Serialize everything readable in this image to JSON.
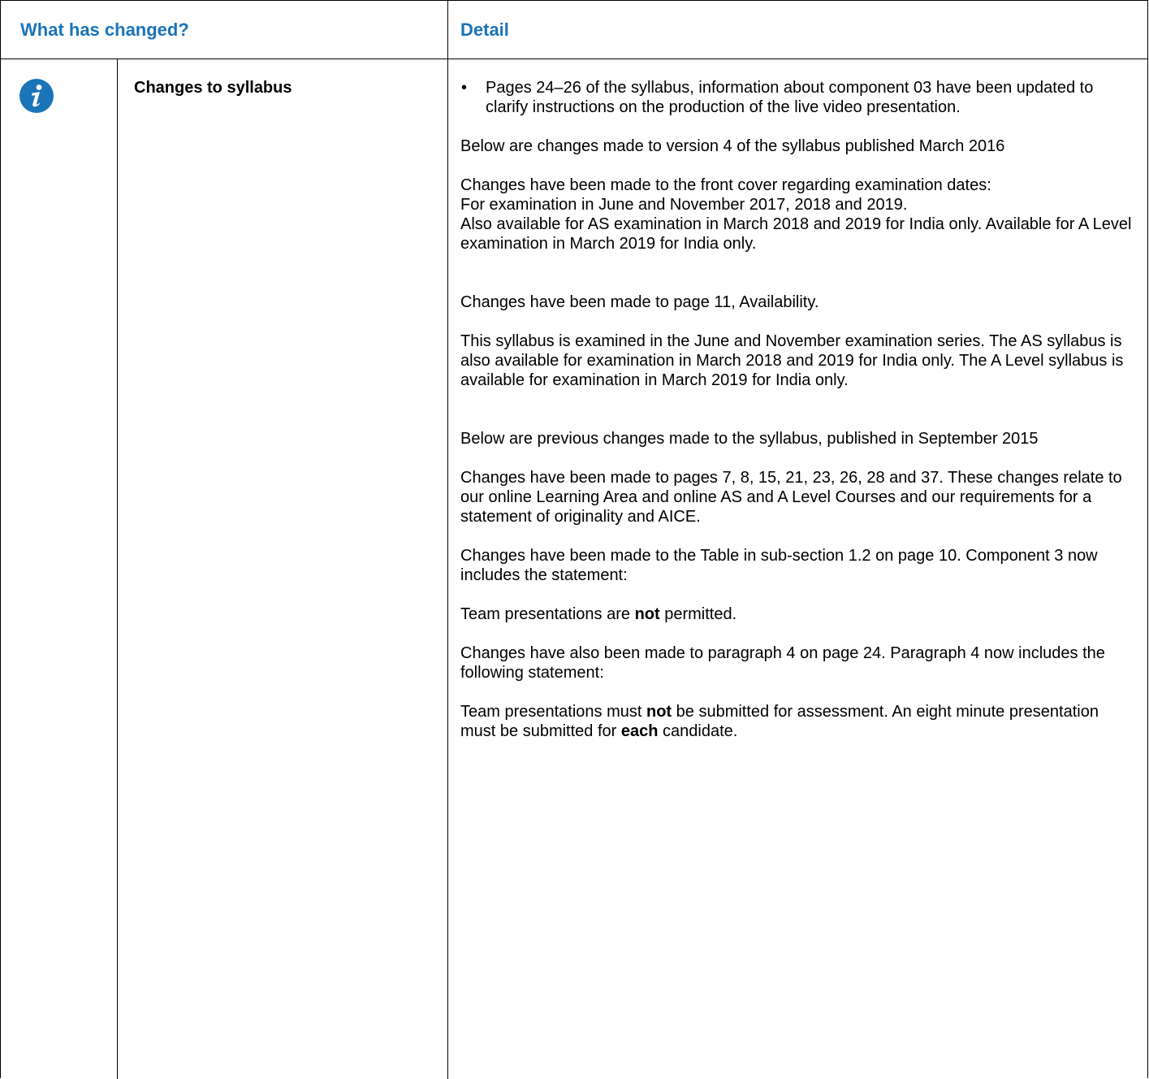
{
  "header": {
    "col_changed": "What has changed?",
    "col_detail": "Detail"
  },
  "icon": {
    "name": "info-icon",
    "color": "#1a74b8"
  },
  "row": {
    "label": "Changes to syllabus",
    "bullet": "Pages 24–26 of the syllabus, information about component 03 have been updated to clarify instructions on the production of the live video presentation.",
    "p1": "Below are changes made to version 4 of the syllabus published March 2016",
    "p2_lines": [
      "Changes have been made to the front cover regarding examination dates:",
      "For examination in June and November 2017, 2018 and 2019.",
      "Also available for AS examination in March 2018 and 2019 for India only. Available for A Level examination in March 2019 for India only."
    ],
    "p3": "Changes have been made to page 11, Availability.",
    "p4": "This syllabus is examined in the June and November examination series. The AS syllabus is also available for examination in March 2018 and 2019 for India only. The A Level syllabus is available for examination in March 2019 for India only.",
    "p5": "Below are previous changes made to the syllabus, published in September 2015",
    "p6": "Changes have been made to pages 7, 8, 15, 21, 23, 26, 28 and 37. These changes relate to our online Learning Area and online AS and A Level Courses and our requirements for a statement of originality and AICE.",
    "p7": "Changes have been made to the Table in sub-section 1.2 on page 10. Component 3 now includes the statement:",
    "p8": {
      "before": "Team presentations are ",
      "bold": "not",
      "after": " permitted."
    },
    "p9": "Changes have also been made to paragraph 4 on page 24. Paragraph 4 now includes the following statement:",
    "p10": {
      "a": "Team presentations must ",
      "b": "not",
      "c": " be submitted for assessment. An eight minute presentation must be submitted for ",
      "d": "each",
      "e": " candidate."
    }
  }
}
